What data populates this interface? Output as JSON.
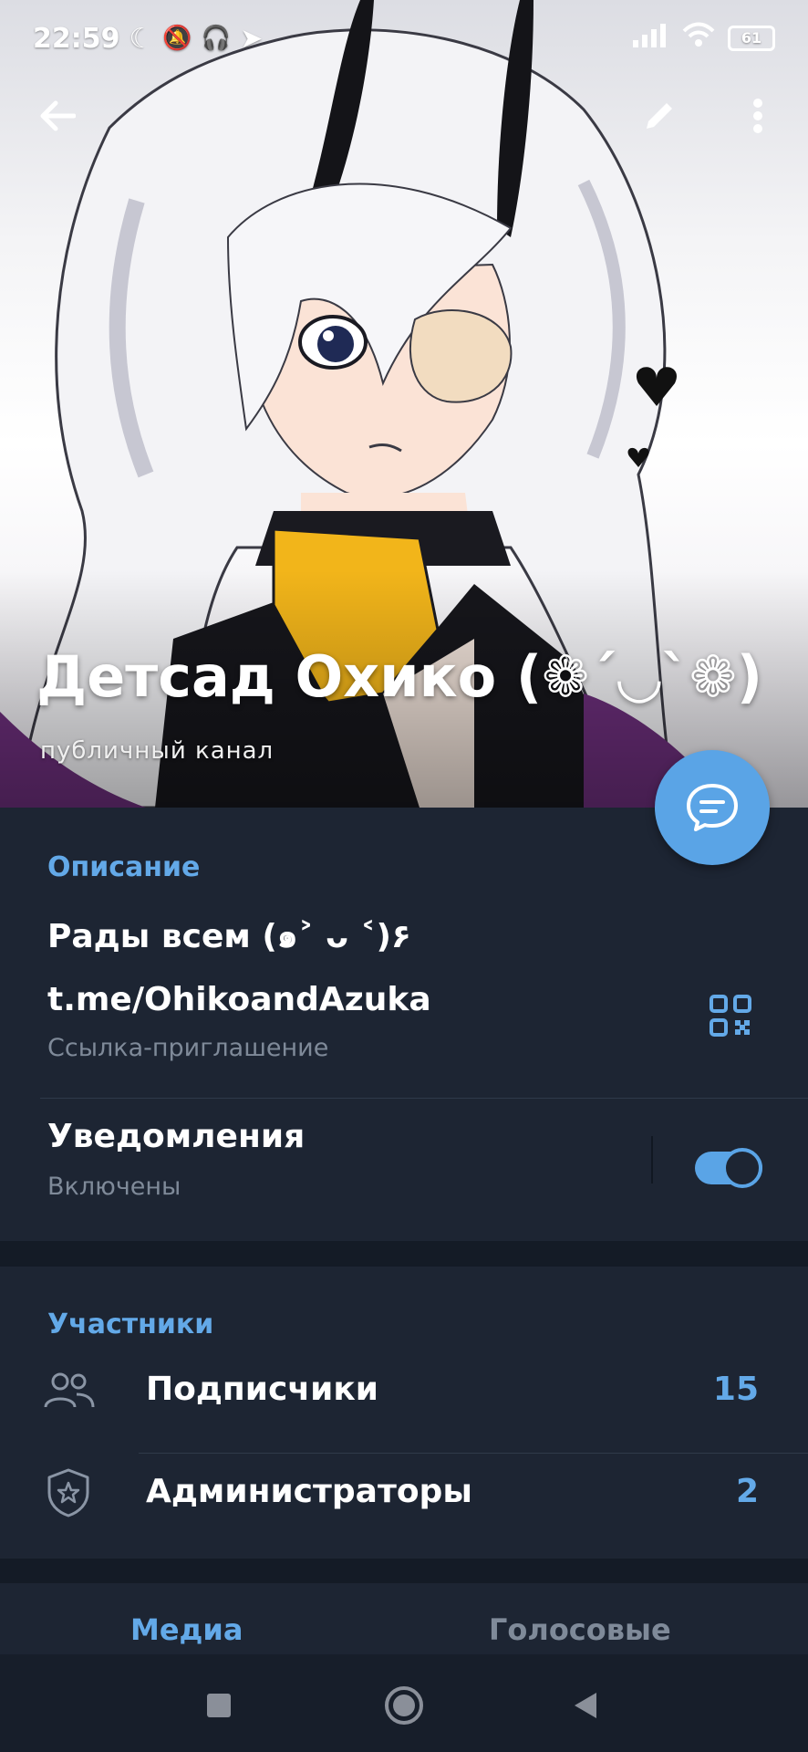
{
  "status_bar": {
    "time": "22:59",
    "battery": "61"
  },
  "channel": {
    "title": "Детсад Охико (❁´◡`❁)",
    "subtitle": "публичный канал"
  },
  "info": {
    "description_header": "Описание",
    "description_text": "Рады всем (๑˃ ᴗ ˂)۶",
    "link": "t.me/OhikoandAzuka",
    "link_caption": "Ссылка-приглашение",
    "notifications_label": "Уведомления",
    "notifications_status": "Включены",
    "notifications_enabled": true
  },
  "members": {
    "header": "Участники",
    "subscribers_label": "Подписчики",
    "subscribers_count": "15",
    "admins_label": "Администраторы",
    "admins_count": "2"
  },
  "tabs": {
    "media": "Медиа",
    "voice": "Голосовые"
  },
  "colors": {
    "accent": "#5aa4e6",
    "background": "#1d2533",
    "secondary_text": "#7f8a99"
  },
  "icons": [
    "back-arrow-icon",
    "pencil-icon",
    "more-vert-icon",
    "comment-icon",
    "qr-code-icon",
    "people-icon",
    "shield-star-icon",
    "nav-square-icon",
    "nav-circle-icon",
    "nav-back-triangle-icon"
  ]
}
